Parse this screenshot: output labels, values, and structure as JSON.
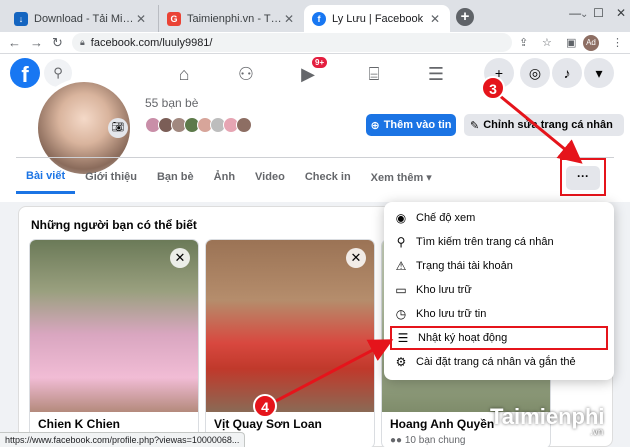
{
  "browser": {
    "tabs": [
      {
        "title": "Download - Tải Miễn Phí VN",
        "color": "#1565c0",
        "fav": "↓"
      },
      {
        "title": "Taimienphi.vn - Tìm trên Goo",
        "color": "#ea4335",
        "fav": "G"
      },
      {
        "title": "Ly Lưu | Facebook",
        "color": "#1877f2",
        "fav": "f"
      }
    ],
    "url": "facebook.com/luuly9981/",
    "profile_initials": "Ad"
  },
  "fb": {
    "logo": "f",
    "watch_badge": "9+"
  },
  "profile": {
    "friends_count": "55 bạn bè",
    "add_story": "Thêm vào tin",
    "edit_profile": "Chỉnh sửa trang cá nhân",
    "more": "···",
    "tabs": [
      "Bài viết",
      "Giới thiệu",
      "Bạn bè",
      "Ảnh",
      "Video",
      "Check in",
      "Xem thêm ▾"
    ]
  },
  "suggestions": {
    "title": "Những người bạn có thể biết",
    "cards": [
      {
        "name": "Chien K Chien"
      },
      {
        "name": "Vịt Quay Sơn Loan"
      },
      {
        "name": "Hoang Anh Quyền"
      }
    ],
    "mutual": "10 bạn chung"
  },
  "menu": {
    "items": [
      {
        "icon": "eye-icon",
        "glyph": "◉",
        "label": "Chế độ xem"
      },
      {
        "icon": "search-icon",
        "glyph": "⚲",
        "label": "Tìm kiếm trên trang cá nhân"
      },
      {
        "icon": "warning-icon",
        "glyph": "⚠",
        "label": "Trạng thái tài khoản"
      },
      {
        "icon": "archive-icon",
        "glyph": "▭",
        "label": "Kho lưu trữ"
      },
      {
        "icon": "clock-icon",
        "glyph": "◷",
        "label": "Kho lưu trữ tin"
      },
      {
        "icon": "list-icon",
        "glyph": "☰",
        "label": "Nhật ký hoạt động"
      },
      {
        "icon": "profile-settings-icon",
        "glyph": "⚙",
        "label": "Cài đặt trang cá nhân và gắn thẻ"
      }
    ]
  },
  "annotations": {
    "step3": "3",
    "step4": "4"
  },
  "statusbar": "https://www.facebook.com/profile.php?viewas=10000068...",
  "watermark": {
    "brand": "Taimienphi",
    "suffix": ".vn"
  },
  "colors": {
    "fb_blue": "#1877f2",
    "annotation_red": "#e5141b"
  }
}
